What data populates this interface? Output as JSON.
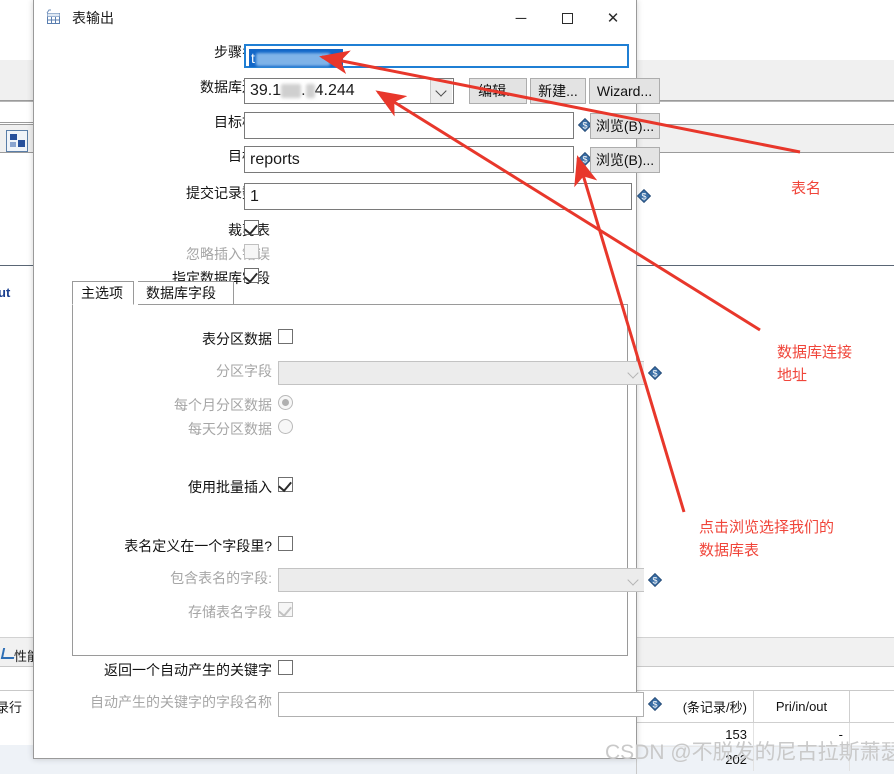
{
  "dialog": {
    "title": "表输出",
    "title_icon": "table-output-icon",
    "window_buttons": [
      {
        "name": "minimize",
        "glyph": "─"
      },
      {
        "name": "maximize",
        "glyph": "☐"
      },
      {
        "name": "close",
        "glyph": "✕"
      }
    ],
    "fields": {
      "step_name": {
        "label": "步骤名称",
        "value": "t█████w",
        "value_prefix": "t",
        "value_suffix": "w",
        "redacted": true
      },
      "db_connection": {
        "label": "数据库连接",
        "value": "39.1██.█4.244",
        "value_parts": [
          "39.1",
          "4.244"
        ],
        "redacted": true
      },
      "target_schema": {
        "label": "目标模式",
        "value": "",
        "browse_label": "浏览(B)..."
      },
      "target_table": {
        "label": "目标表",
        "value": "reports",
        "browse_label": "浏览(B)..."
      },
      "commit_size": {
        "label": "提交记录数量",
        "value": "1"
      },
      "truncate_table": {
        "label": "裁剪表",
        "checked": true,
        "enabled": true
      },
      "ignore_insert_errors": {
        "label": "忽略插入错误",
        "checked": false,
        "enabled": false
      },
      "specify_db_fields": {
        "label": "指定数据库字段",
        "checked": true,
        "enabled": true
      }
    },
    "connection_buttons": [
      {
        "name": "edit-connection-button",
        "label": "编辑..."
      },
      {
        "name": "new-connection-button",
        "label": "新建..."
      },
      {
        "name": "wizard-connection-button",
        "label": "Wizard..."
      }
    ],
    "tabs": [
      {
        "name": "tab-main-options",
        "label": "主选项",
        "active": true
      },
      {
        "name": "tab-database-fields",
        "label": "数据库字段",
        "active": false
      }
    ],
    "main_options": {
      "partition_data": {
        "label": "表分区数据",
        "checked": false,
        "enabled": true
      },
      "partition_field": {
        "label": "分区字段",
        "value": "",
        "enabled": false
      },
      "partition_monthly": {
        "label": "每个月分区数据",
        "selected": true,
        "enabled": false
      },
      "partition_daily": {
        "label": "每天分区数据",
        "selected": false,
        "enabled": false
      },
      "use_batch_insert": {
        "label": "使用批量插入",
        "checked": true,
        "enabled": true
      },
      "table_name_in_field": {
        "label": "表名定义在一个字段里?",
        "checked": false,
        "enabled": true
      },
      "field_with_table_name": {
        "label": "包含表名的字段:",
        "value": "",
        "enabled": false
      },
      "store_table_name_field": {
        "label": "存储表名字段",
        "checked": true,
        "enabled": false
      },
      "return_auto_key": {
        "label": "返回一个自动产生的关键字",
        "checked": false,
        "enabled": true
      },
      "auto_key_field_name": {
        "label": "自动产生的关键字的字段名称",
        "value": "",
        "enabled": false
      }
    }
  },
  "annotations": [
    {
      "name": "annotation-table-name",
      "text": "表名",
      "color": "#f0453a"
    },
    {
      "name": "annotation-db-connection-address",
      "text": "数据库连接\n地址",
      "color": "#f0453a"
    },
    {
      "name": "annotation-click-browse",
      "text": "点击浏览选择我们的\n数据库表",
      "color": "#f0453a"
    }
  ],
  "background": {
    "left_fragments": [
      {
        "name": "bg-fragment-out-label",
        "text": "ut"
      },
      {
        "name": "bg-fragment-performance-label",
        "text": "性能"
      },
      {
        "name": "bg-fragment-log-label",
        "text": "录行"
      }
    ],
    "table": {
      "headers": [
        "(条记录/秒)",
        "Pri/in/out",
        ""
      ],
      "rows": [
        [
          "153",
          "-",
          ""
        ],
        [
          "202",
          "",
          ""
        ]
      ]
    }
  },
  "watermark": {
    "text": "CSDN @不脱发的尼古拉斯萧瑟"
  }
}
